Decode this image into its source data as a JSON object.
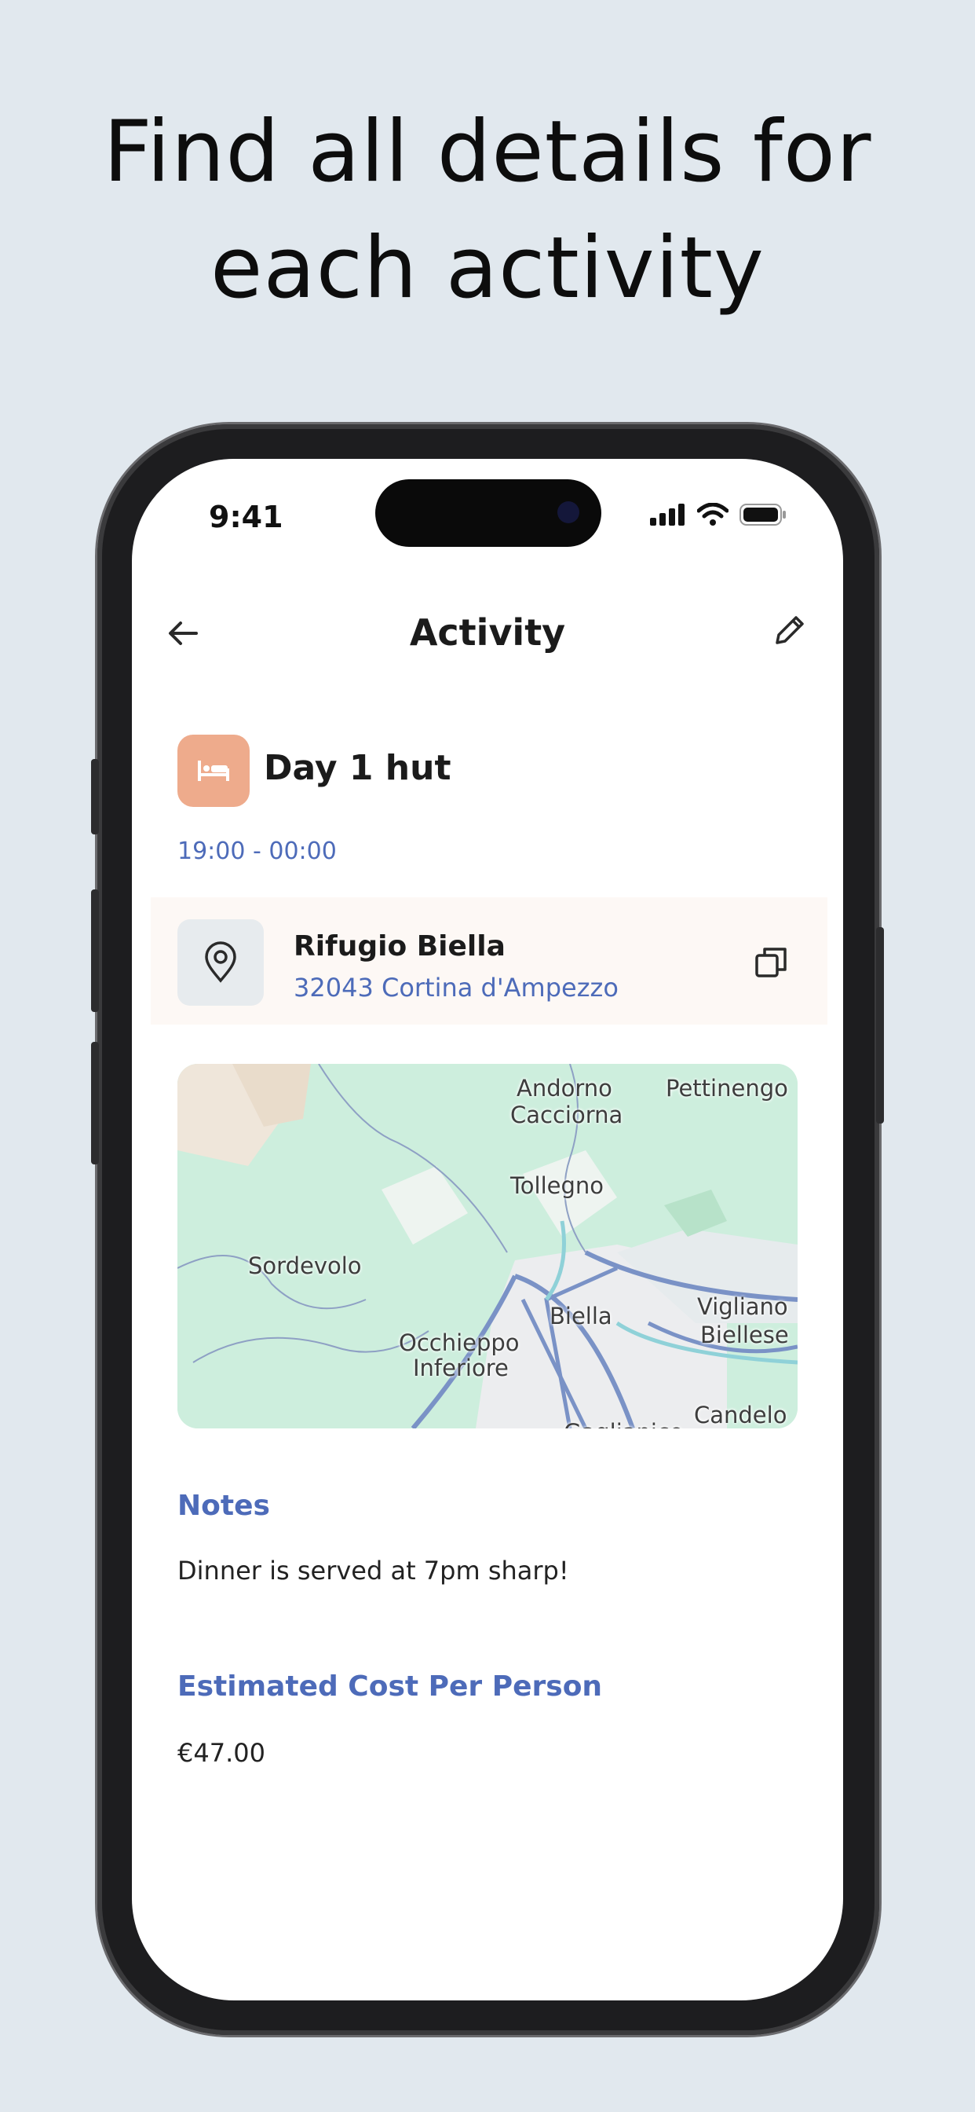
{
  "headline": {
    "line1": "Find all details for",
    "line2": "each activity"
  },
  "status_bar": {
    "time": "9:41"
  },
  "nav": {
    "title": "Activity"
  },
  "activity": {
    "icon": "bed-icon",
    "title": "Day 1 hut",
    "time_range": "19:00 - 00:00"
  },
  "location": {
    "name": "Rifugio Biella",
    "address": "32043 Cortina d'Ampezzo"
  },
  "map": {
    "labels": [
      "Andorno",
      "Cacciorna",
      "Pettinengo",
      "Tollegno",
      "Sordevolo",
      "Biella",
      "Vigliano",
      "Biellese",
      "Occhieppo",
      "Inferiore",
      "Candelo",
      "Gaglianico"
    ]
  },
  "notes": {
    "label": "Notes",
    "text": "Dinner is served at 7pm sharp!"
  },
  "cost": {
    "label": "Estimated Cost Per Person",
    "value": "€47.00"
  },
  "colors": {
    "accent": "#4d6bb9",
    "activity_icon_bg": "#eeab8c",
    "background": "#e1e8ee"
  }
}
